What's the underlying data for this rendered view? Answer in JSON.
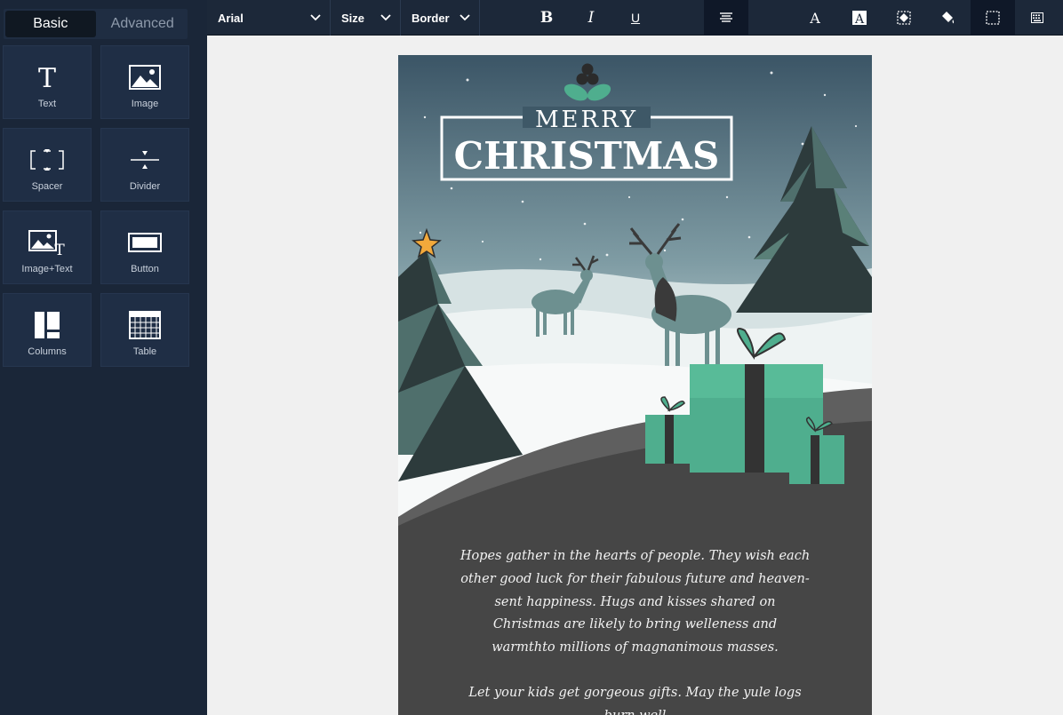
{
  "sidebar": {
    "tabs": [
      {
        "label": "Basic",
        "active": true
      },
      {
        "label": "Advanced",
        "active": false
      }
    ],
    "blocks": [
      {
        "label": "Text",
        "icon": "text-icon"
      },
      {
        "label": "Image",
        "icon": "image-icon"
      },
      {
        "label": "Spacer",
        "icon": "spacer-icon"
      },
      {
        "label": "Divider",
        "icon": "divider-icon"
      },
      {
        "label": "Image+Text",
        "icon": "image-text-icon"
      },
      {
        "label": "Button",
        "icon": "button-icon"
      },
      {
        "label": "Columns",
        "icon": "columns-icon"
      },
      {
        "label": "Table",
        "icon": "table-icon"
      }
    ]
  },
  "toolbar": {
    "font": "Arial",
    "size": "Size",
    "border": "Border",
    "bold": "B",
    "italic": "I",
    "underline": "U"
  },
  "email": {
    "header_small": "MERRY",
    "header_big": "CHRISTMAS",
    "paragraphs": [
      "Hopes gather in the hearts of people. They wish each other good luck for their fabulous future and heaven-sent happiness. Hugs and kisses shared on Christmas are likely to bring welleness and warmthto millions of magnanimous masses.",
      "Let your kids get gorgeous gifts. May the yule logs burn well"
    ]
  },
  "colors": {
    "sidebar_bg": "#1a2638",
    "toolbar_bg": "#1c2839",
    "gift_green": "#4fae8e",
    "tree_dark": "#2c3a3a",
    "ground_dark": "#464646"
  }
}
